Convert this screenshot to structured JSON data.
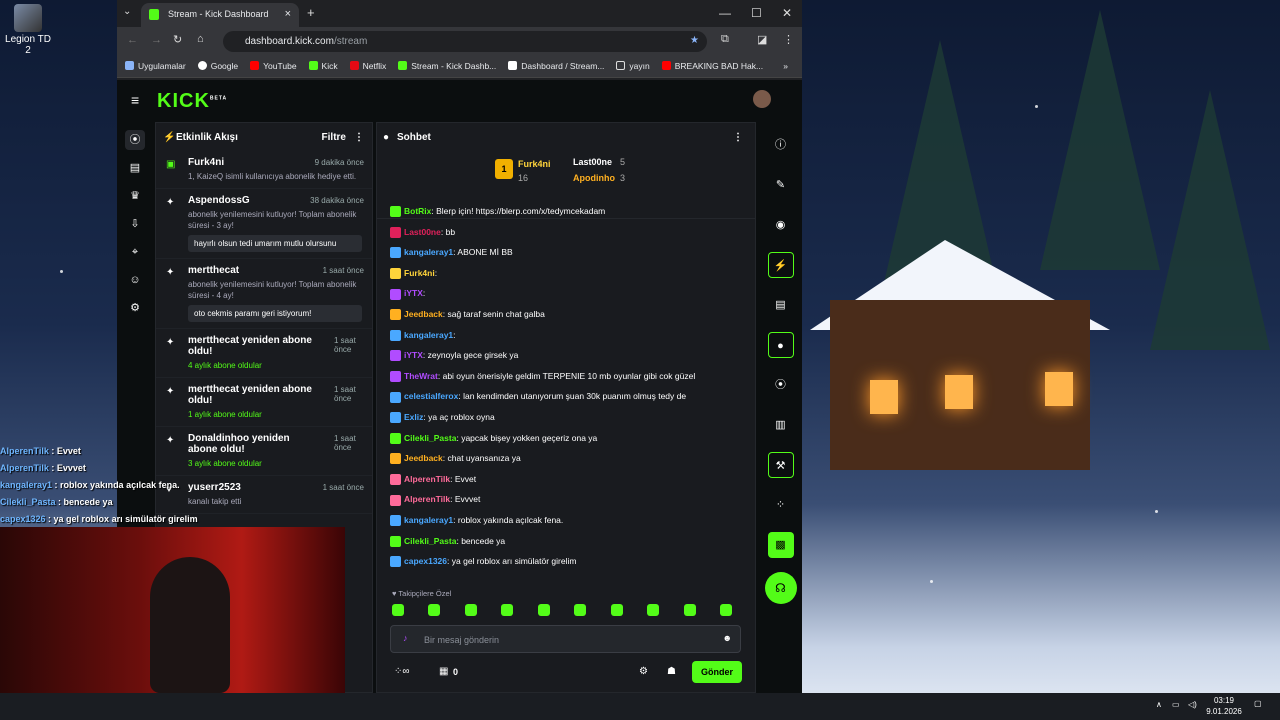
{
  "desktop": {
    "icon_label": "Legion TD 2"
  },
  "browser": {
    "tab_title": "Stream - Kick Dashboard",
    "url_host": "dashboard.kick.com",
    "url_path": "/stream",
    "bookmarks": [
      "Uygulamalar",
      "Google",
      "YouTube",
      "Kick",
      "Netflix",
      "Stream - Kick Dashb...",
      "Dashboard / Stream...",
      "yayın",
      "BREAKING BAD Hak..."
    ]
  },
  "kick": {
    "logo": "KICK",
    "logo_sup": "BETA",
    "activity": {
      "title": "Etkinlik Akışı",
      "filter": "Filtre",
      "items": [
        {
          "who": "Furk4ni",
          "when": "9 dakika önce",
          "desc": "1, KaizeQ isimli kullanıcıya abonelik hediye etti.",
          "msg": ""
        },
        {
          "who": "AspendossG",
          "when": "38 dakika önce",
          "desc": "abonelik yenilemesini kutluyor! Toplam abonelik süresi - 3 ay!",
          "msg": "hayırlı olsun tedi umarım mutlu olursunu"
        },
        {
          "who": "mertthecat",
          "when": "1 saat önce",
          "desc": "abonelik yenilemesini kutluyor! Toplam abonelik süresi - 4 ay!",
          "msg": "oto cekmis paramı geri istiyorum!"
        },
        {
          "who": "mertthecat yeniden abone oldu!",
          "when": "1 saat önce",
          "desc": "4 aylık abone oldular",
          "msg": ""
        },
        {
          "who": "mertthecat yeniden abone oldu!",
          "when": "1 saat önce",
          "desc": "1 aylık abone oldular",
          "msg": ""
        },
        {
          "who": "Donaldinhoo yeniden abone oldu!",
          "when": "1 saat önce",
          "desc": "3 aylık abone oldular",
          "msg": ""
        },
        {
          "who": "yuserr2523",
          "when": "1 saat önce",
          "desc": "kanalı takip etti",
          "msg": ""
        }
      ]
    },
    "chat": {
      "title": "Sohbet",
      "leaders": [
        {
          "name": "Furk4ni",
          "rank": "1",
          "count": "16"
        },
        {
          "name": "Last00ne",
          "rank": "",
          "count": "5"
        },
        {
          "name": "Apodinho",
          "rank": "",
          "count": "3"
        }
      ],
      "messages": [
        {
          "user": "BotRix",
          "color": "#53fc18",
          "text": "Blerp için! https://blerp.com/x/tedymcekadam"
        },
        {
          "user": "Last00ne",
          "color": "#e0215b",
          "text": "bb"
        },
        {
          "user": "kangaleray1",
          "color": "#4aa8ff",
          "text": "ABONE Mİ BB"
        },
        {
          "user": "Furk4ni",
          "color": "#ffd43b",
          "text": ""
        },
        {
          "user": "iYTX",
          "color": "#b14cff",
          "text": ""
        },
        {
          "user": "Jeedback",
          "color": "#ffb020",
          "text": "sağ taraf senin chat galba"
        },
        {
          "user": "kangaleray1",
          "color": "#4aa8ff",
          "text": ""
        },
        {
          "user": "iYTX",
          "color": "#b14cff",
          "text": "zeynoyla gece girsek ya"
        },
        {
          "user": "TheWrat",
          "color": "#b14cff",
          "text": "abi oyun önerisiyle geldim TERPENIE 10 mb oyunlar gibi cok güzel"
        },
        {
          "user": "celestialferox",
          "color": "#4aa8ff",
          "text": "lan kendimden utanıyorum şuan 30k puanım olmuş tedy de"
        },
        {
          "user": "Exliz",
          "color": "#4aa8ff",
          "text": "ya aç roblox oyna"
        },
        {
          "user": "Cilekli_Pasta",
          "color": "#53fc18",
          "text": "yapcak bişey yokken geçeriz ona ya"
        },
        {
          "user": "Jeedback",
          "color": "#ffb020",
          "text": "chat uyansanıza ya"
        },
        {
          "user": "AlperenTilk",
          "color": "#ff6b9a",
          "text": "Evvet"
        },
        {
          "user": "AlperenTilk",
          "color": "#ff6b9a",
          "text": "Evvvet"
        },
        {
          "user": "kangaleray1",
          "color": "#4aa8ff",
          "text": "roblox yakında açılcak fena."
        },
        {
          "user": "Cilekli_Pasta",
          "color": "#53fc18",
          "text": "bencede ya"
        },
        {
          "user": "capex1326",
          "color": "#4aa8ff",
          "text": "ya gel roblox arı simülatör girelim"
        }
      ],
      "followers_only": "Takipçilere Özel",
      "input_placeholder": "Bir mesaj gönderin",
      "points": "0",
      "send": "Gönder"
    }
  },
  "overlay_chat": [
    {
      "user": "AlperenTilk",
      "text": "Evvet"
    },
    {
      "user": "AlperenTilk",
      "text": "Evvvet"
    },
    {
      "user": "kangaleray1",
      "text": "roblox yakında açılcak fena."
    },
    {
      "user": "Cilekli_Pasta",
      "text": "bencede ya"
    },
    {
      "user": "capex1326",
      "text": "ya gel roblox arı simülatör girelim"
    }
  ],
  "taskbar": {
    "time": "03:19",
    "date": "9.01.2026"
  }
}
